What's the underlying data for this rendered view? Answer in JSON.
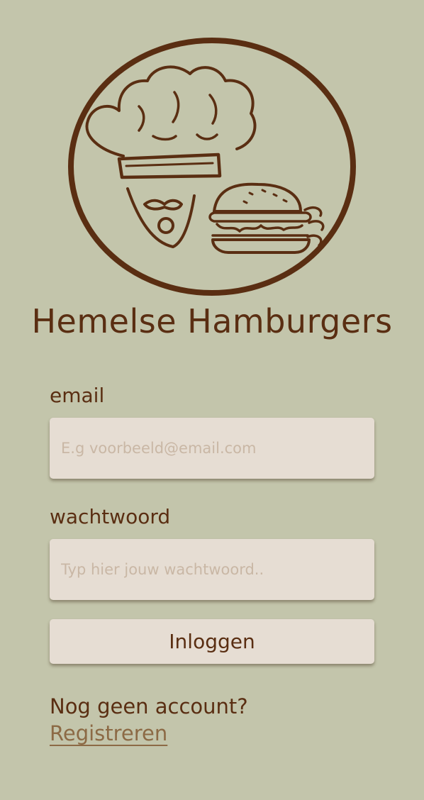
{
  "brand": {
    "logo_icon": "chef-burger-logo",
    "title": "Hemelse Hamburgers"
  },
  "login_form": {
    "email_label": "email",
    "email_placeholder": "E.g voorbeeld@email.com",
    "email_value": "",
    "password_label": "wachtwoord",
    "password_placeholder": "Typ hier jouw wachtwoord..",
    "password_value": "",
    "login_button_label": "Inloggen"
  },
  "footer": {
    "no_account_text": "Nog geen account?",
    "register_link_label": "Registreren"
  },
  "colors": {
    "background": "#c3c5ab",
    "primary_brown": "#5a2e12",
    "field_background": "#e6ddd3",
    "placeholder": "#c9b7a5",
    "link": "#8c6a45"
  }
}
